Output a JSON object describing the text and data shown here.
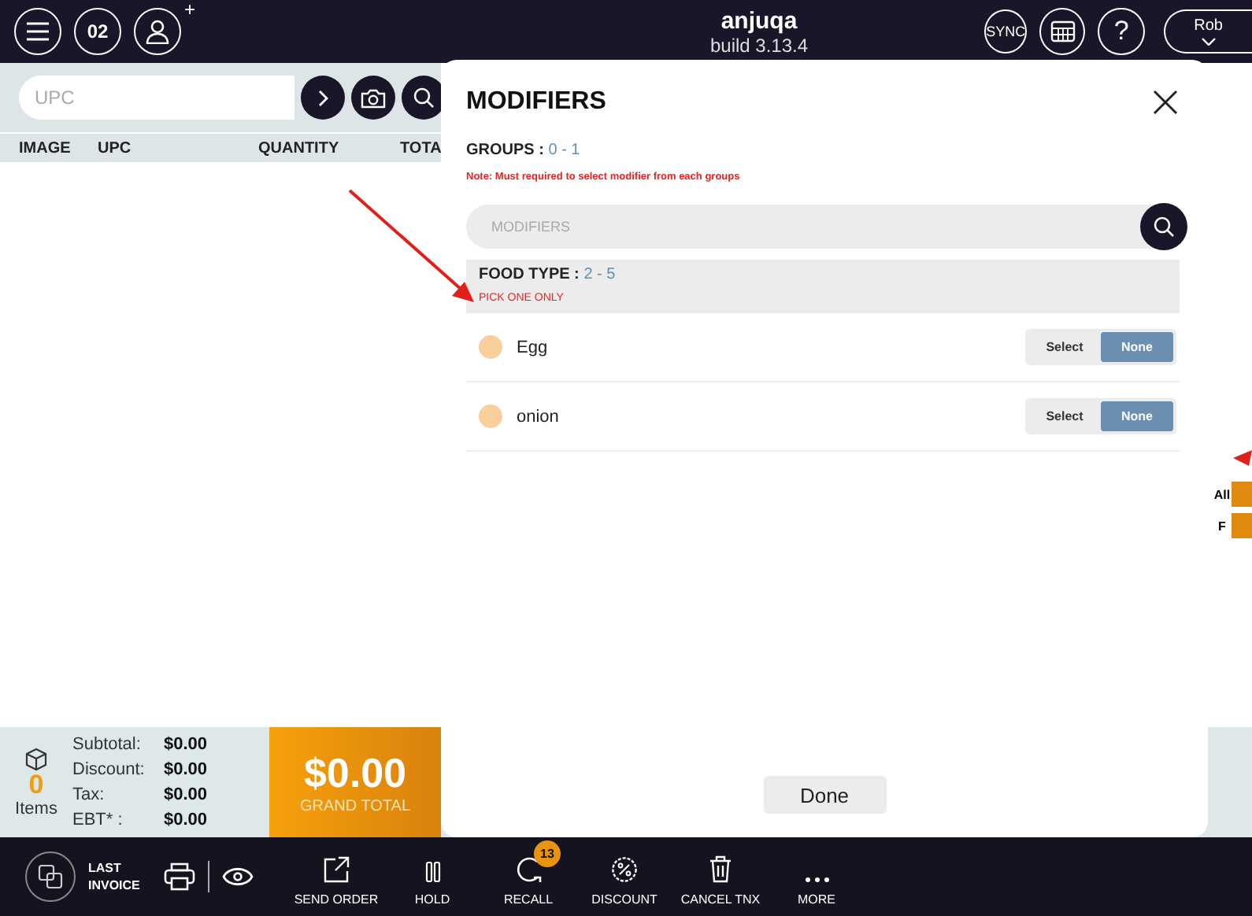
{
  "top_bar": {
    "title": "anjuqa",
    "subtitle": "build 3.13.4",
    "calendar_day": "02",
    "add_mark": "+",
    "sync_label": "SYNC",
    "help_label": "?",
    "user": "Rob"
  },
  "scan_bar": {
    "placeholder": "UPC"
  },
  "cart_table": {
    "columns": [
      "IMAGE",
      "UPC",
      "QUANTITY",
      "TOTA"
    ]
  },
  "side_strip": {
    "labels": [
      "All",
      "F"
    ]
  },
  "summary": {
    "item_count": "0",
    "items_label": "Items",
    "lines": [
      {
        "label": "Subtotal:",
        "value": "$0.00"
      },
      {
        "label": "Discount:",
        "value": "$0.00"
      },
      {
        "label": "Tax:",
        "value": "$0.00"
      },
      {
        "label": "EBT* :",
        "value": "$0.00"
      }
    ],
    "grand_total": "$0.00",
    "grand_total_label": "GRAND TOTAL"
  },
  "modal": {
    "title": "MODIFIERS",
    "groups_label": "GROUPS :",
    "groups_range": "0 - 1",
    "note": "Note: Must required to select modifier from each groups",
    "search_placeholder": "MODIFIERS",
    "group": {
      "name": "FOOD TYPE :",
      "range": "2 - 5",
      "hint": "PICK ONE ONLY",
      "items": [
        {
          "name": "Egg",
          "options": [
            {
              "label": "Select",
              "selected": false
            },
            {
              "label": "None",
              "selected": true
            }
          ]
        },
        {
          "name": "onion",
          "options": [
            {
              "label": "Select",
              "selected": false
            },
            {
              "label": "None",
              "selected": true
            }
          ]
        }
      ]
    },
    "done": "Done"
  },
  "bottom_bar": {
    "last_invoice": "LAST INVOICE",
    "actions": [
      {
        "kind": "send",
        "label": "SEND ORDER"
      },
      {
        "kind": "hold",
        "label": "HOLD"
      },
      {
        "kind": "recall",
        "label": "RECALL",
        "badge": "13"
      },
      {
        "kind": "discount",
        "label": "DISCOUNT"
      },
      {
        "kind": "trash",
        "label": "CANCEL TNX"
      },
      {
        "kind": "more",
        "label": "MORE"
      }
    ]
  }
}
